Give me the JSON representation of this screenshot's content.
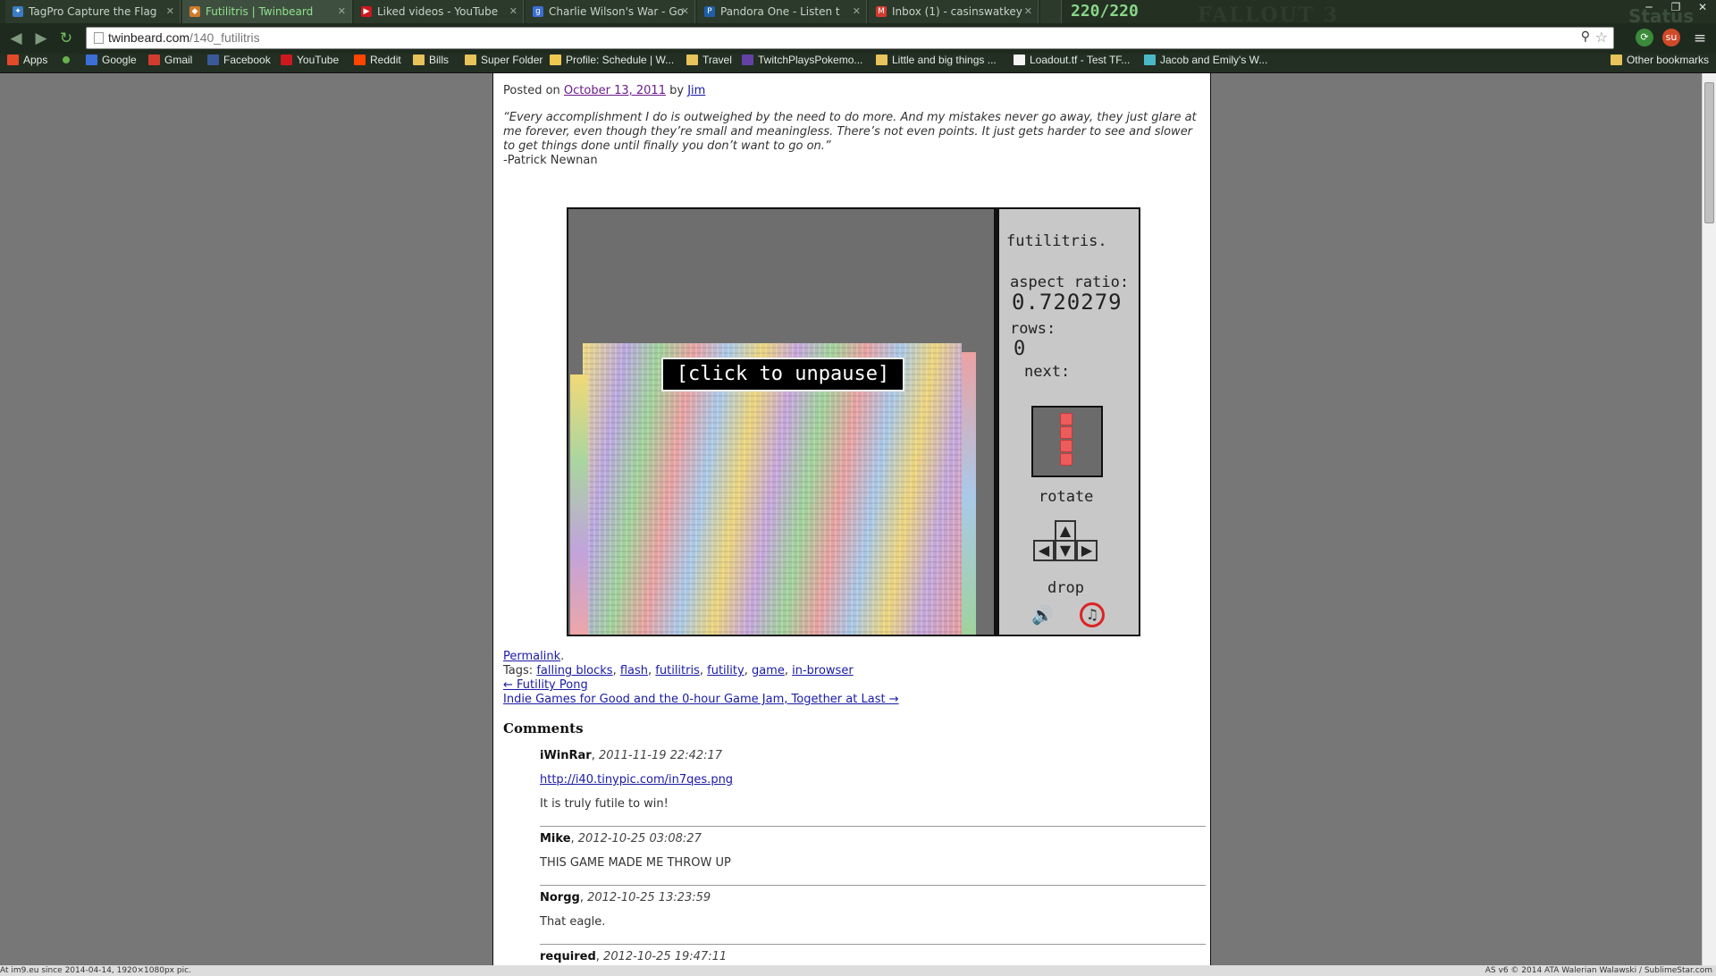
{
  "tabs": [
    {
      "title": "TagPro Capture the Flag",
      "icon": "tagpro",
      "color": "#3a7cc4"
    },
    {
      "title": "Futilitris | Twinbeard",
      "icon": "twinbeard",
      "color": "#d07a2a"
    },
    {
      "title": "Liked videos - YouTube",
      "icon": "youtube",
      "color": "#cc181e"
    },
    {
      "title": "Charlie Wilson's War - Go",
      "icon": "google-search",
      "color": "#3b6fd6"
    },
    {
      "title": "Pandora One - Listen t",
      "icon": "pandora",
      "color": "#1f5fa8"
    },
    {
      "title": "Inbox (1) - casinswatkey",
      "icon": "gmail",
      "color": "#d13c2f"
    }
  ],
  "tabbar": {
    "hud": "220/220",
    "deco": "FALLOUT 3",
    "deco2": "Status"
  },
  "window_controls": {
    "min": "─",
    "max": "❐",
    "close": "✕"
  },
  "address": {
    "host": "twinbeard.com",
    "path": "/140_futilitris"
  },
  "bookmarks": [
    {
      "label": "Apps",
      "icon": "apps-grid-icon",
      "color": "#e24a2a"
    },
    {
      "label": "",
      "icon": "green-dot-icon",
      "color": "#6ab04c"
    },
    {
      "label": "Google",
      "icon": "google-icon",
      "color": "#3b6fd6"
    },
    {
      "label": "Gmail",
      "icon": "gmail-icon",
      "color": "#d13c2f"
    },
    {
      "label": "Facebook",
      "icon": "facebook-icon",
      "color": "#3b5998"
    },
    {
      "label": "YouTube",
      "icon": "youtube-icon",
      "color": "#cc181e"
    },
    {
      "label": "Reddit",
      "icon": "reddit-icon",
      "color": "#ff4500"
    },
    {
      "label": "Bills",
      "icon": "folder-icon",
      "color": "#e8c25a"
    },
    {
      "label": "Super Folder",
      "icon": "folder-icon",
      "color": "#e8c25a"
    },
    {
      "label": "Profile: Schedule | W...",
      "icon": "profile-icon",
      "color": "#f0c850"
    },
    {
      "label": "Travel",
      "icon": "folder-icon",
      "color": "#e8c25a"
    },
    {
      "label": "TwitchPlaysPokemo...",
      "icon": "twitch-icon",
      "color": "#6441a5"
    },
    {
      "label": "Little and big things ...",
      "icon": "folder-icon",
      "color": "#e8c25a"
    },
    {
      "label": "Loadout.tf - Test TF...",
      "icon": "page-icon",
      "color": "#f5f5f5"
    },
    {
      "label": "Jacob and Emily's W...",
      "icon": "wedding-icon",
      "color": "#4bb8c8"
    }
  ],
  "other_bookmarks": "Other bookmarks",
  "post": {
    "posted_on": "Posted on",
    "date": "October 13, 2011",
    "by": "by",
    "author": "Jim",
    "quote": "“Every accomplishment I do is outweighed by the need to do more. And my mistakes never go away, they just glare at me forever, even though they’re small and meaningless. There’s not even points. It just gets harder to see and slower to get things done until finally you don’t want to go on.”",
    "quote_by": "-Patrick Newnan"
  },
  "game": {
    "title": "futilitris.",
    "aspect_label": "aspect ratio:",
    "aspect_value": "0.720279",
    "rows_label": "rows:",
    "rows_value": "0",
    "next_label": "next:",
    "rotate_label": "rotate",
    "drop_label": "drop",
    "unpause": "[click to unpause]",
    "keys": {
      "up": "▲",
      "left": "◀",
      "down": "▼",
      "right": "▶"
    }
  },
  "links": {
    "permalink": "Permalink",
    "tags_label": "Tags:",
    "tags": [
      "falling blocks",
      "flash",
      "futilitris",
      "futility",
      "game",
      "in-browser"
    ],
    "prev": "← Futility Pong",
    "next": "Indie Games for Good and the 0-hour Game Jam, Together at Last →"
  },
  "comments_heading": "Comments",
  "comments": [
    {
      "author": "iWinRar",
      "date": "2011-11-19 22:42:17",
      "link": "http://i40.tinypic.com/in7qes.png",
      "body": "It is truly futile to win!"
    },
    {
      "author": "Mike",
      "date": "2012-10-25 03:08:27",
      "body": "THIS GAME MADE ME THROW UP"
    },
    {
      "author": "Norgg",
      "date": "2012-10-25 13:23:59",
      "body": "That eagle."
    },
    {
      "author": "required",
      "date": "2012-10-25 19:47:11",
      "body": ""
    }
  ],
  "statusbar": {
    "left": "At im9.eu since 2014-04-14, 1920×1080px pic.",
    "right": "AS v6 © 2014 ATA Walerian Walawski / SublimeStar.com"
  }
}
